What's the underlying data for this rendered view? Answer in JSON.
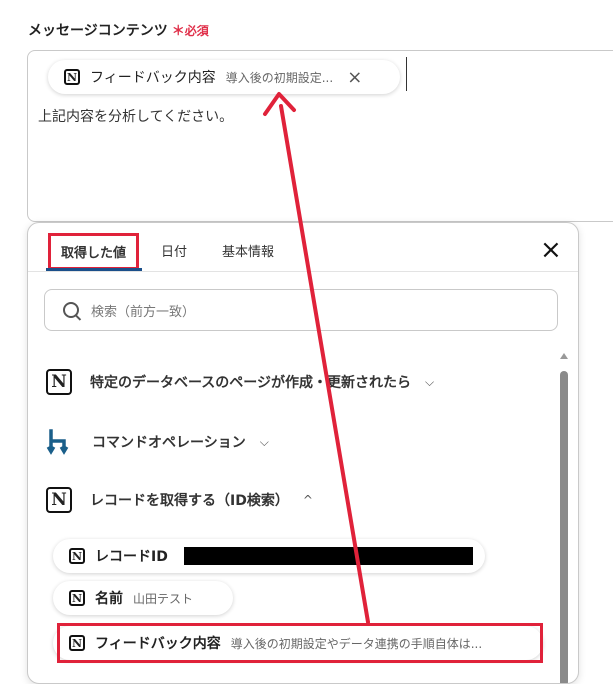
{
  "field": {
    "label": "メッセージコンテンツ",
    "required_mark": "＊",
    "required_text": "必須"
  },
  "message_box": {
    "chip": {
      "icon": "notion-icon",
      "name": "フィードバック内容",
      "value": "導入後の初期設定...",
      "close": "×"
    },
    "text": "上記内容を分析してください。"
  },
  "panel": {
    "tabs": [
      {
        "label": "取得した値"
      },
      {
        "label": "日付"
      },
      {
        "label": "基本情報"
      }
    ],
    "close": "×",
    "search": {
      "placeholder": "検索（前方一致）"
    },
    "sections": [
      {
        "label": "特定のデータベースのページが作成・更新されたら",
        "icon": "notion-icon"
      },
      {
        "label": "コマンドオペレーション",
        "icon": "yoom-icon"
      },
      {
        "label": "レコードを取得する（ID検索）",
        "icon": "notion-icon",
        "expanded": true
      }
    ],
    "items": [
      {
        "name": "レコードID",
        "value": ""
      },
      {
        "name": "名前",
        "value": "山田テスト"
      },
      {
        "name": "フィードバック内容",
        "value": "導入後の初期設定やデータ連携の手順自体は..."
      }
    ]
  },
  "colors": {
    "highlight": "#e0223a",
    "tab_underline": "#1a4f8a",
    "yoom_icon": "#1a5f8a"
  },
  "notion_glyph": "N"
}
